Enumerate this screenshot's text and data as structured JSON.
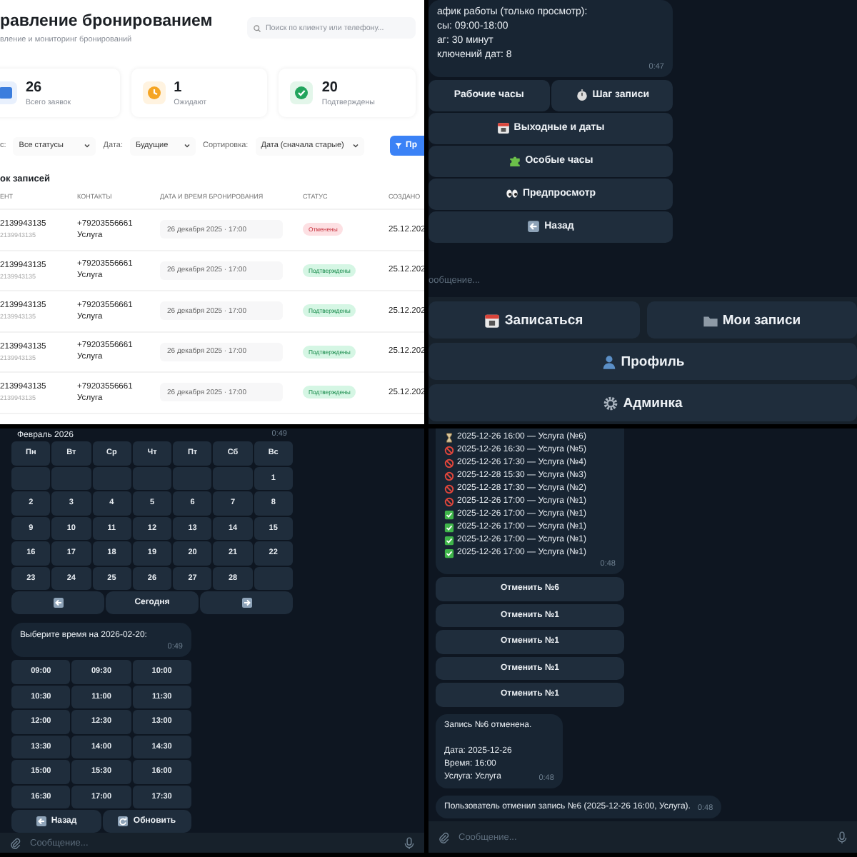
{
  "admin_panel": {
    "title": "равление бронированием",
    "subtitle": "вление и мониторинг бронирований",
    "search": {
      "placeholder": "Поиск по клиенту или телефону..."
    },
    "stats": [
      {
        "kind": "total",
        "value": "26",
        "label": "Всего заявок"
      },
      {
        "kind": "pending",
        "value": "1",
        "label": "Ожидают"
      },
      {
        "kind": "confirmed",
        "value": "20",
        "label": "Подтверждены"
      }
    ],
    "filters": [
      {
        "label": "с:",
        "value": "Все статусы"
      },
      {
        "label": "Дата:",
        "value": "Будущие"
      },
      {
        "label": "Сортировка:",
        "value": "Дата (сначала старые)"
      }
    ],
    "apply_button": "Пр",
    "section_title": "ок записей",
    "table": {
      "columns": [
        "ЕНТ",
        "КОНТАКТЫ",
        "ДАТА И ВРЕМЯ БРОНИРОВАНИЯ",
        "СТАТУС",
        "СОЗДАНО"
      ],
      "rows": [
        {
          "client": "2139943135",
          "client_id": "2139943135",
          "phone": "+79203556661",
          "service": "Услуга",
          "datetime": "26 декабря 2025 · 17:00",
          "status": {
            "kind": "cancelled",
            "label": "Отменены"
          },
          "created": "25.12.202"
        },
        {
          "client": "2139943135",
          "client_id": "2139943135",
          "phone": "+79203556661",
          "service": "Услуга",
          "datetime": "26 декабря 2025 · 17:00",
          "status": {
            "kind": "confirmed",
            "label": "Подтверждены"
          },
          "created": "25.12.202"
        },
        {
          "client": "2139943135",
          "client_id": "2139943135",
          "phone": "+79203556661",
          "service": "Услуга",
          "datetime": "26 декабря 2025 · 17:00",
          "status": {
            "kind": "confirmed",
            "label": "Подтверждены"
          },
          "created": "25.12.202"
        },
        {
          "client": "2139943135",
          "client_id": "2139943135",
          "phone": "+79203556661",
          "service": "Услуга",
          "datetime": "26 декабря 2025 · 17:00",
          "status": {
            "kind": "confirmed",
            "label": "Подтверждены"
          },
          "created": "25.12.202"
        },
        {
          "client": "2139943135",
          "client_id": "2139943135",
          "phone": "+79203556661",
          "service": "Услуга",
          "datetime": "26 декабря 2025 · 17:00",
          "status": {
            "kind": "confirmed",
            "label": "Подтверждены"
          },
          "created": "25.12.202"
        }
      ]
    }
  },
  "settings_chat": {
    "message": {
      "lines": [
        "афик работы (только просмотр):",
        "сы: 09:00-18:00",
        "аг: 30 минут",
        "ключений дат: 8"
      ],
      "time": "0:47"
    },
    "inline_buttons": [
      [
        {
          "label": "Рабочие часы"
        },
        {
          "label": "Шаг записи"
        }
      ],
      [
        {
          "label": "Выходные и даты"
        }
      ],
      [
        {
          "label": "Особые часы"
        }
      ],
      [
        {
          "label": "Предпросмотр"
        }
      ],
      [
        {
          "label": "Назад"
        }
      ]
    ],
    "input": {
      "placeholder": "ообщение..."
    },
    "keyboard": [
      [
        {
          "label": "Записаться"
        },
        {
          "label": "Мои записи"
        }
      ],
      [
        {
          "label": "Профиль"
        }
      ],
      [
        {
          "label": "Админка"
        }
      ]
    ]
  },
  "booking_chat": {
    "calendar_message": {
      "title": "Февраль 2026",
      "time": "0:49",
      "weekdays": [
        "Пн",
        "Вт",
        "Ср",
        "Чт",
        "Пт",
        "Сб",
        "Вс"
      ],
      "weeks": [
        [
          "1"
        ],
        [
          "2",
          "3",
          "4",
          "5",
          "6",
          "7",
          "8"
        ],
        [
          "9",
          "10",
          "11",
          "12",
          "13",
          "14",
          "15"
        ],
        [
          "16",
          "17",
          "18",
          "19",
          "20",
          "21",
          "22"
        ],
        [
          "23",
          "24",
          "25",
          "26",
          "27",
          "28"
        ]
      ],
      "nav": [
        {
          "kind": "prev"
        },
        {
          "kind": "today",
          "label": "Сегодня"
        },
        {
          "kind": "next"
        }
      ]
    },
    "time_message": {
      "text": "Выберите время на 2026-02-20:",
      "time": "0:49",
      "slots": [
        "09:00",
        "09:30",
        "10:00",
        "10:30",
        "11:00",
        "11:30",
        "12:00",
        "12:30",
        "13:00",
        "13:30",
        "14:00",
        "14:30",
        "15:00",
        "15:30",
        "16:00",
        "16:30",
        "17:00",
        "17:30"
      ]
    },
    "actions": [
      {
        "label": "Назад"
      },
      {
        "label": "Обновить"
      }
    ],
    "input": {
      "placeholder": "Сообщение..."
    }
  },
  "bookings_chat": {
    "list_message": {
      "time": "0:48",
      "items": [
        {
          "kind": "pending",
          "text": "2025-12-26 16:00 — Услуга (№6)"
        },
        {
          "kind": "cancelled",
          "text": "2025-12-26 16:30 — Услуга (№5)"
        },
        {
          "kind": "cancelled",
          "text": "2025-12-26 17:30 — Услуга (№4)"
        },
        {
          "kind": "cancelled",
          "text": "2025-12-28 15:30 — Услуга (№3)"
        },
        {
          "kind": "cancelled",
          "text": "2025-12-28 17:30 — Услуга (№2)"
        },
        {
          "kind": "cancelled",
          "text": "2025-12-26 17:00 — Услуга (№1)"
        },
        {
          "kind": "confirmed",
          "text": "2025-12-26 17:00 — Услуга (№1)"
        },
        {
          "kind": "confirmed",
          "text": "2025-12-26 17:00 — Услуга (№1)"
        },
        {
          "kind": "confirmed",
          "text": "2025-12-26 17:00 — Услуга (№1)"
        },
        {
          "kind": "confirmed",
          "text": "2025-12-26 17:00 — Услуга (№1)"
        }
      ]
    },
    "cancel_buttons": [
      "Отменить №6",
      "Отменить №1",
      "Отменить №1",
      "Отменить №1",
      "Отменить №1"
    ],
    "messages": [
      {
        "paragraphs": [
          [
            "Запись №6 отменена."
          ],
          [
            "Дата: 2025-12-26",
            "Время: 16:00",
            "Услуга: Услуга"
          ]
        ],
        "time": "0:48"
      },
      {
        "paragraphs": [
          [
            "Пользователь отменил запись №6 (2025-12-26 16:00, Услуга)."
          ]
        ],
        "time": "0:48"
      }
    ],
    "input": {
      "placeholder": "Сообщение..."
    }
  }
}
